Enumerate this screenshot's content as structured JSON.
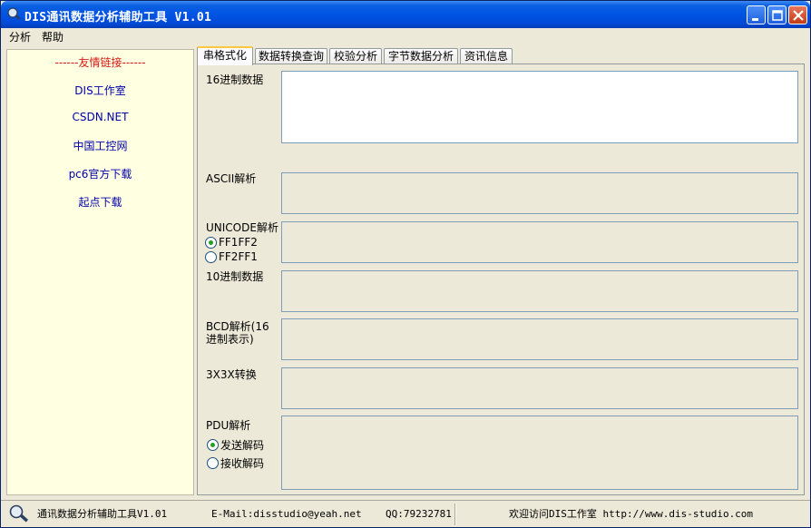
{
  "window": {
    "title": "DIS通讯数据分析辅助工具 V1.01",
    "icons": [
      "app-icon",
      "minimize-icon",
      "maximize-icon",
      "close-icon"
    ]
  },
  "menu": {
    "analyze": "分析",
    "help": "帮助"
  },
  "sidebar": {
    "title": "------友情链接------",
    "links": [
      "DIS工作室",
      "CSDN.NET",
      "中国工控网",
      "pc6官方下载",
      "起点下载"
    ]
  },
  "tabs": [
    "串格式化",
    "数据转换查询",
    "校验分析",
    "字节数据分析",
    "资讯信息"
  ],
  "active_tab": "串格式化",
  "form": {
    "hex_label": "16进制数据",
    "ascii_label": "ASCII解析",
    "unicode_label": "UNICODE解析",
    "unicode_opt1": "FF1FF2",
    "unicode_opt2": "FF2FF1",
    "dec_label": "10进制数据",
    "bcd_label": "BCD解析(16\n进制表示)",
    "x3x3_label": "3X3X转换",
    "pdu_label": "PDU解析",
    "pdu_opt1": "发送解码",
    "pdu_opt2": "接收解码"
  },
  "status": {
    "app_name": "通讯数据分析辅助工具V1.01",
    "email": "E-Mail:disstudio@yeah.net",
    "qq": "QQ:79232781",
    "welcome": "欢迎访问DIS工作室 http://www.dis-studio.com"
  },
  "colors": {
    "titlebar": "#0054e3",
    "sidebar_bg": "#ffffe1",
    "link": "#0000aa",
    "link_title": "#d81818",
    "radio_dot": "#21a121"
  }
}
